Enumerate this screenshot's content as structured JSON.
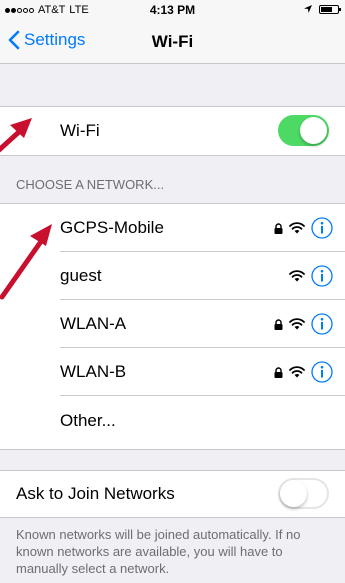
{
  "status_bar": {
    "carrier": "AT&T",
    "network": "LTE",
    "time": "4:13 PM"
  },
  "nav": {
    "back_label": "Settings",
    "title": "Wi-Fi"
  },
  "wifi_row": {
    "label": "Wi-Fi",
    "toggle_on": true
  },
  "networks": {
    "section_header": "CHOOSE A NETWORK...",
    "items": [
      {
        "name": "GCPS-Mobile",
        "secured": true
      },
      {
        "name": "guest",
        "secured": false
      },
      {
        "name": "WLAN-A",
        "secured": true
      },
      {
        "name": "WLAN-B",
        "secured": true
      }
    ],
    "other_label": "Other..."
  },
  "ask_join": {
    "label": "Ask to Join Networks",
    "toggle_on": false,
    "footer": "Known networks will be joined automatically. If no known networks are available, you will have to manually select a network."
  },
  "colors": {
    "accent": "#007aff",
    "toggle_on": "#4cd964",
    "annotation_arrow": "#c8102e"
  }
}
